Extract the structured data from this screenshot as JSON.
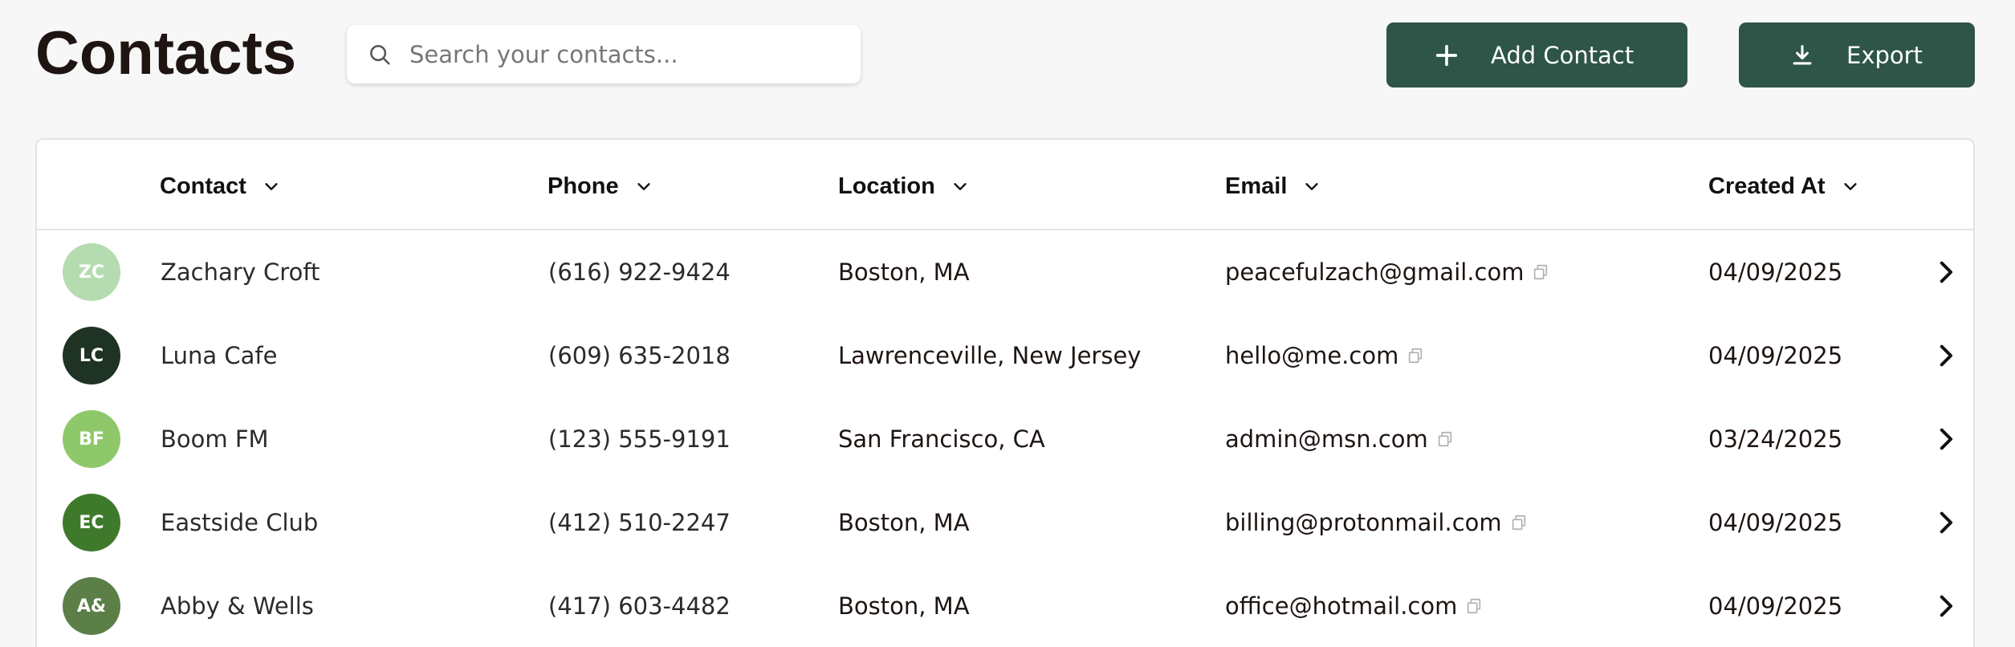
{
  "header": {
    "title": "Contacts",
    "search": {
      "placeholder": "Search your contacts...",
      "value": ""
    },
    "add_button": "Add Contact",
    "export_button": "Export"
  },
  "table": {
    "columns": [
      "Contact",
      "Phone",
      "Location",
      "Email",
      "Created At"
    ],
    "rows": [
      {
        "initials": "ZC",
        "avatar_color": "#b5dcb0",
        "name": "Zachary Croft",
        "phone": "(616) 922-9424",
        "location": "Boston, MA",
        "email": "peacefulzach@gmail.com",
        "created_at": "04/09/2025"
      },
      {
        "initials": "LC",
        "avatar_color": "#1f3324",
        "name": "Luna Cafe",
        "phone": "(609) 635-2018",
        "location": "Lawrenceville, New Jersey",
        "email": "hello@me.com",
        "created_at": "04/09/2025"
      },
      {
        "initials": "BF",
        "avatar_color": "#8fc86b",
        "name": "Boom FM",
        "phone": "(123) 555-9191",
        "location": "San Francisco, CA",
        "email": "admin@msn.com",
        "created_at": "03/24/2025"
      },
      {
        "initials": "EC",
        "avatar_color": "#3f7a2c",
        "name": "Eastside Club",
        "phone": "(412) 510-2247",
        "location": "Boston, MA",
        "email": "billing@protonmail.com",
        "created_at": "04/09/2025"
      },
      {
        "initials": "A&",
        "avatar_color": "#5b7f47",
        "name": "Abby & Wells",
        "phone": "(417) 603-4482",
        "location": "Boston, MA",
        "email": "office@hotmail.com",
        "created_at": "04/09/2025"
      }
    ]
  },
  "icons": {
    "search": "search-icon",
    "add": "plus-icon",
    "export": "download-icon",
    "sort": "chevron-down-icon",
    "copy": "copy-icon",
    "row_open": "chevron-right-icon"
  },
  "colors": {
    "accent": "#2e5547",
    "background": "#f7f7f7",
    "title": "#1e1512"
  }
}
